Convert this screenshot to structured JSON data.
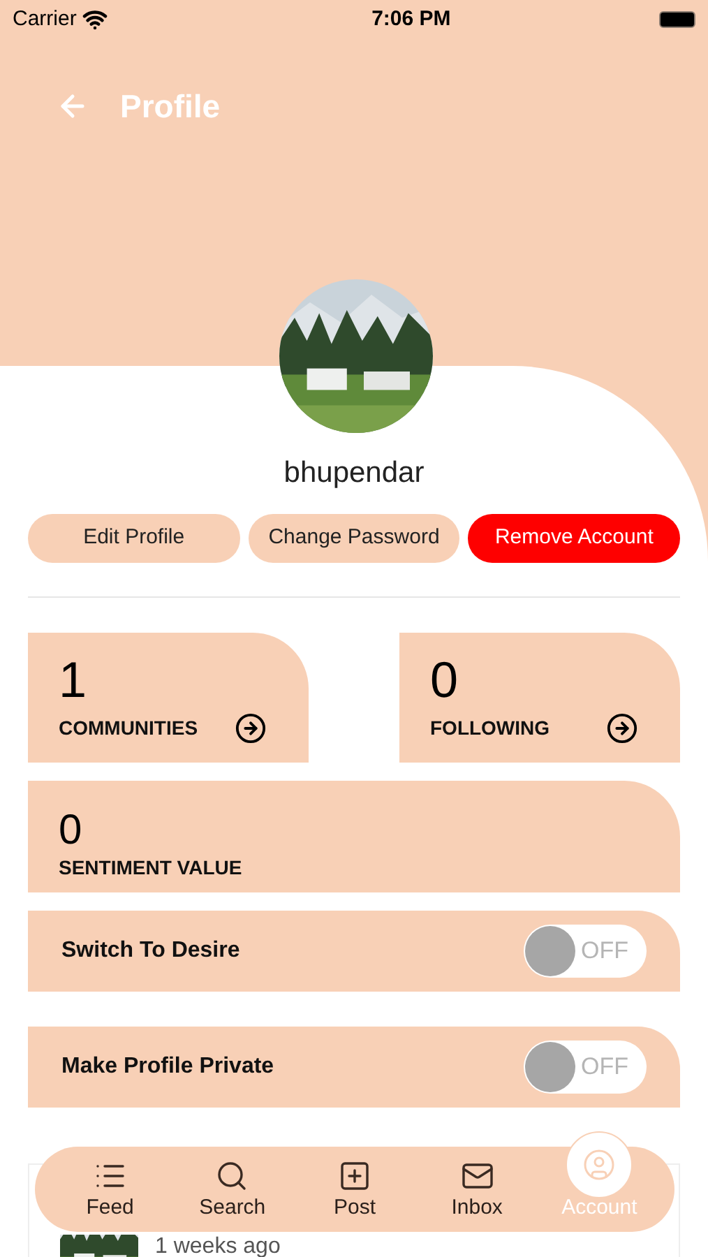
{
  "status_bar": {
    "carrier": "Carrier",
    "time": "7:06 PM"
  },
  "header": {
    "title": "Profile"
  },
  "profile": {
    "name": "bhupendar"
  },
  "actions": [
    {
      "label": "Edit Profile",
      "kind": "plain"
    },
    {
      "label": "Change Password",
      "kind": "plain"
    },
    {
      "label": "Remove Account",
      "kind": "danger"
    }
  ],
  "stats": [
    {
      "value": "1",
      "label": "COMMUNITIES",
      "kind": "link"
    },
    {
      "value": "0",
      "label": "FOLLOWING",
      "kind": "link"
    },
    {
      "value": "0",
      "label": "SENTIMENT VALUE",
      "kind": "plain"
    }
  ],
  "toggles": [
    {
      "label": "Switch To Desire",
      "on": false,
      "state_text": "OFF"
    },
    {
      "label": "Make Profile Private",
      "on": false,
      "state_text": "OFF"
    }
  ],
  "post": {
    "time": "1 weeks ago"
  },
  "tab_bar": [
    {
      "label": "Feed",
      "selected": false
    },
    {
      "label": "Search",
      "selected": false
    },
    {
      "label": "Post",
      "selected": false
    },
    {
      "label": "Inbox",
      "selected": false
    },
    {
      "label": "Account",
      "selected": true
    }
  ]
}
